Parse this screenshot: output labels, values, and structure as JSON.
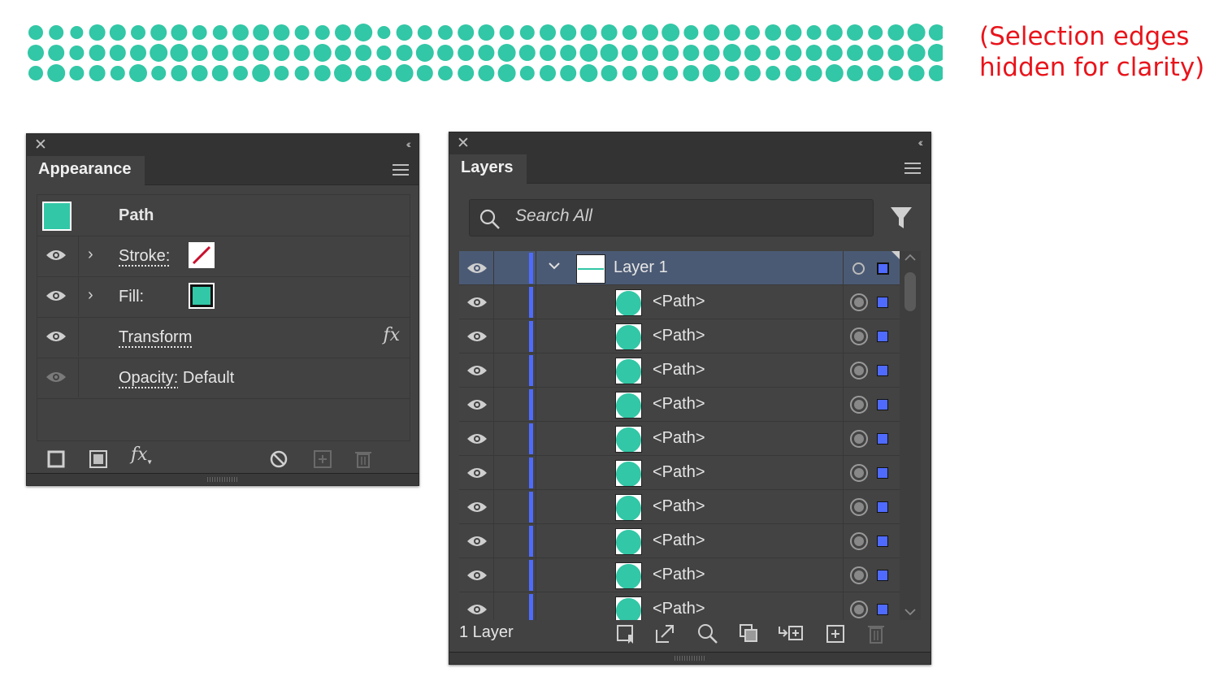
{
  "note": {
    "line1": "(Selection edges",
    "line2": "hidden for clarity)"
  },
  "colors": {
    "accent_dot": "#32c7a6",
    "note_red": "#e8141b",
    "layer_color": "#4f6bff",
    "panel_bg": "#424242"
  },
  "dots": {
    "rows": 3,
    "color": "#32c7a6"
  },
  "appearance": {
    "tab": "Appearance",
    "target": "Path",
    "stroke_label": "Stroke:",
    "fill_label": "Fill:",
    "transform_label": "Transform",
    "fx_label": "fx",
    "opacity_label": "Opacity:",
    "opacity_value": "Default",
    "footer_icons": [
      "add-stroke-icon",
      "add-fill-icon",
      "fx-menu-icon",
      "clear-appearance-icon",
      "duplicate-item-icon",
      "delete-item-icon"
    ]
  },
  "layers": {
    "tab": "Layers",
    "search_placeholder": "Search All",
    "layer_name": "Layer 1",
    "items": [
      "<Path>",
      "<Path>",
      "<Path>",
      "<Path>",
      "<Path>",
      "<Path>",
      "<Path>",
      "<Path>",
      "<Path>",
      "<Path>"
    ],
    "footer_count": "1 Layer",
    "footer_icons": [
      "collect-export-icon",
      "export-icon",
      "locate-object-icon",
      "clipping-mask-icon",
      "new-sublayer-icon",
      "new-layer-icon",
      "delete-icon"
    ]
  }
}
